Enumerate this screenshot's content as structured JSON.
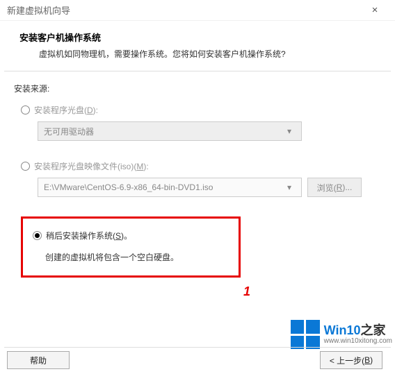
{
  "window": {
    "title": "新建虚拟机向导",
    "close": "×"
  },
  "header": {
    "title": "安装客户机操作系统",
    "subtitle": "虚拟机如同物理机，需要操作系统。您将如何安装客户机操作系统?"
  },
  "source_label": "安装来源:",
  "option_disc": {
    "label_pre": "安装程序光盘(",
    "hotkey": "D",
    "label_post": "):",
    "dropdown_text": "无可用驱动器"
  },
  "option_iso": {
    "label_pre": "安装程序光盘映像文件(iso)(",
    "hotkey": "M",
    "label_post": "):",
    "path": "E:\\VMware\\CentOS-6.9-x86_64-bin-DVD1.iso",
    "browse_pre": "浏览(",
    "browse_hot": "R",
    "browse_post": ")..."
  },
  "option_later": {
    "label_pre": "稍后安装操作系统(",
    "hotkey": "S",
    "label_post": ")。",
    "desc": "创建的虚拟机将包含一个空白硬盘。"
  },
  "marker": "1",
  "buttons": {
    "help": "帮助",
    "back_pre": "< 上一步(",
    "back_hot": "B",
    "back_post": ")"
  },
  "watermark": {
    "brand_en": "Win10",
    "brand_zh": "之家",
    "url": "www.win10xitong.com"
  }
}
